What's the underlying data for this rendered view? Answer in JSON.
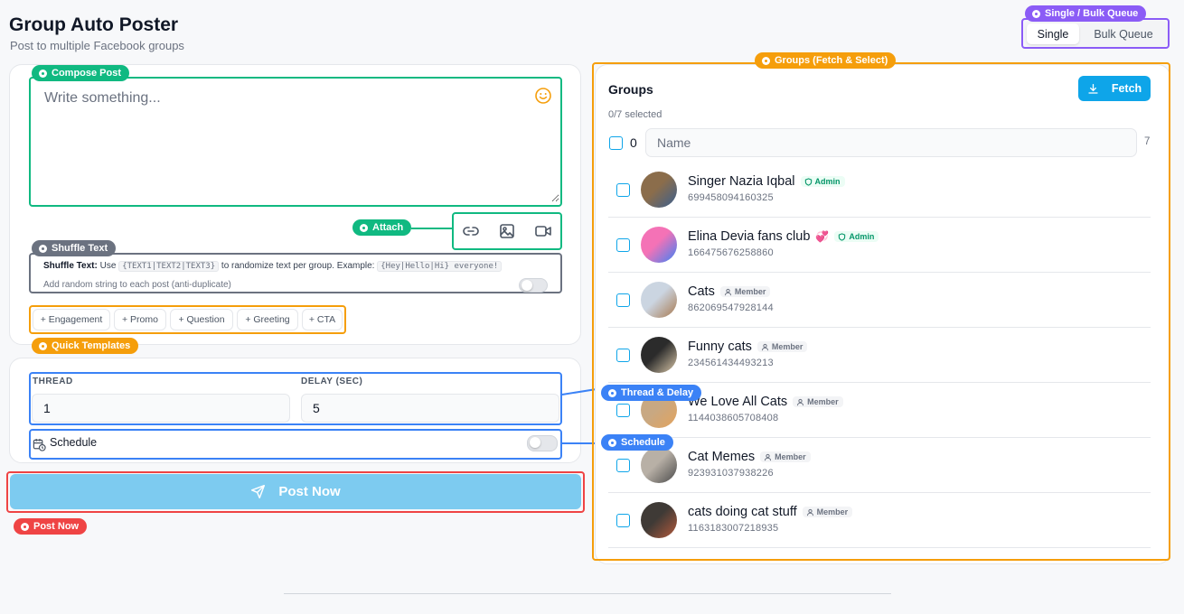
{
  "header": {
    "title": "Group Auto Poster",
    "subtitle": "Post to multiple Facebook groups"
  },
  "mode": {
    "badge": "Single / Bulk Queue",
    "single_label": "Single",
    "bulk_label": "Bulk Queue",
    "selected": "Single"
  },
  "compose": {
    "badge": "Compose Post",
    "placeholder": "Write something...",
    "attach_badge": "Attach"
  },
  "shuffle": {
    "badge": "Shuffle Text",
    "title": "Shuffle Text:",
    "use": "Use",
    "pattern": "{TEXT1|TEXT2|TEXT3}",
    "mid": "to randomize text per group. Example:",
    "example": "{Hey|Hello|Hi} everyone!",
    "random_string_label": "Add random string to each post (anti-duplicate)",
    "random_string_enabled": false
  },
  "templates": {
    "badge": "Quick Templates",
    "items": [
      "+ Engagement",
      "+ Promo",
      "+ Question",
      "+ Greeting",
      "+ CTA"
    ]
  },
  "settings": {
    "thread_delay_badge": "Thread & Delay",
    "thread_label": "THREAD",
    "thread_value": "1",
    "delay_label": "DELAY (SEC)",
    "delay_value": "5",
    "schedule_badge": "Schedule",
    "schedule_label": "Schedule",
    "schedule_enabled": false
  },
  "post": {
    "badge": "Post Now",
    "label": "Post Now"
  },
  "groups": {
    "badge": "Groups (Fetch & Select)",
    "title": "Groups",
    "fetch_label": "Fetch",
    "selected_text": "0/7 selected",
    "select_all_count": "0",
    "search_placeholder": "Name",
    "total": "7",
    "items": [
      {
        "name": "Singer Nazia Iqbal",
        "emoji": "",
        "role": "Admin",
        "id": "699458094160325"
      },
      {
        "name": "Elina Devia fans club",
        "emoji": "💞",
        "role": "Admin",
        "id": "166475676258860"
      },
      {
        "name": "Cats",
        "emoji": "",
        "role": "Member",
        "id": "862069547928144"
      },
      {
        "name": "Funny cats",
        "emoji": "",
        "role": "Member",
        "id": "234561434493213"
      },
      {
        "name": "We Love All Cats",
        "emoji": "",
        "role": "Member",
        "id": "1144038605708408"
      },
      {
        "name": "Cat Memes",
        "emoji": "",
        "role": "Member",
        "id": "923931037938226"
      },
      {
        "name": "cats doing cat stuff",
        "emoji": "",
        "role": "Member",
        "id": "1163183007218935"
      }
    ]
  },
  "colors": {
    "accent": "#0ea5e9",
    "post_button": "#7dcbf0",
    "compose_outline": "#10b981",
    "groups_outline": "#f59e0b",
    "settings_outline": "#3b82f6",
    "mode_outline": "#8b5cf6",
    "post_outline": "#ef4444"
  }
}
